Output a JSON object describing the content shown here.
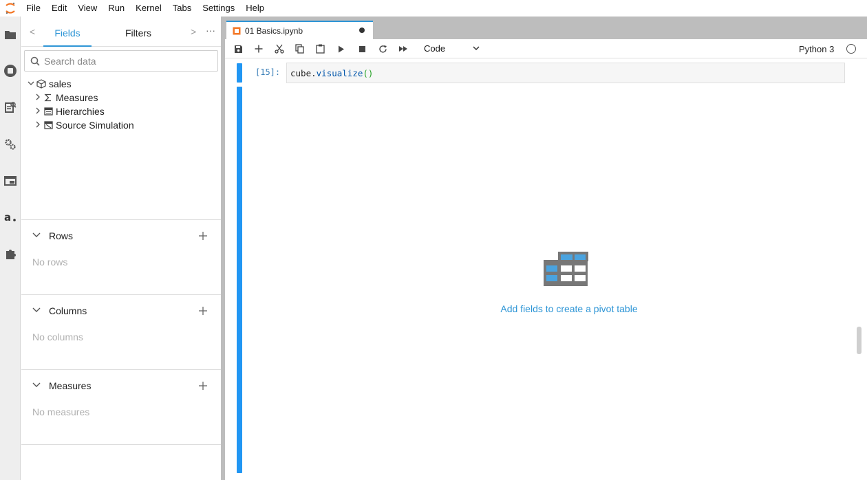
{
  "menubar": {
    "items": [
      "File",
      "Edit",
      "View",
      "Run",
      "Kernel",
      "Tabs",
      "Settings",
      "Help"
    ]
  },
  "leftbar": {
    "icons": [
      "folder-icon",
      "running-icon",
      "commands-icon",
      "property-inspector-icon",
      "tabs-icon",
      "atoti-icon",
      "extension-icon"
    ]
  },
  "panel": {
    "tabs": {
      "left_arrow": "<",
      "fields": "Fields",
      "filters": "Filters",
      "right_arrow": ">",
      "more": "···"
    },
    "search": {
      "placeholder": "Search data",
      "value": ""
    },
    "tree": {
      "root": "sales",
      "children": [
        "Measures",
        "Hierarchies",
        "Source Simulation"
      ]
    },
    "sections": [
      {
        "title": "Rows",
        "empty": "No rows"
      },
      {
        "title": "Columns",
        "empty": "No columns"
      },
      {
        "title": "Measures",
        "empty": "No measures"
      }
    ]
  },
  "notebook": {
    "tab_title": "01 Basics.ipynb",
    "cell_type": "Code",
    "kernel_name": "Python 3",
    "cell": {
      "prompt": "[15]:",
      "code_obj": "cube",
      "code_dot": ".",
      "code_fn": "visualize",
      "code_parens": "()"
    },
    "pivot_message": "Add fields to create a pivot table"
  },
  "colors": {
    "accent": "#2d95d6",
    "cell_bar": "#2196f3",
    "pivot_grid": "#777777",
    "pivot_cell_blue": "#4aa3df"
  }
}
